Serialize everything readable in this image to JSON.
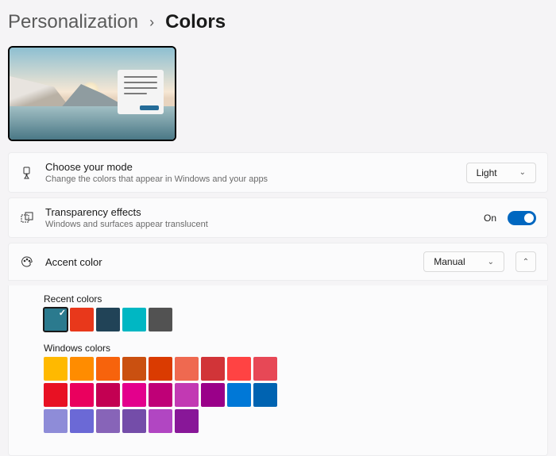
{
  "breadcrumb": {
    "parent": "Personalization",
    "current": "Colors"
  },
  "mode": {
    "title": "Choose your mode",
    "desc": "Change the colors that appear in Windows and your apps",
    "value": "Light"
  },
  "transparency": {
    "title": "Transparency effects",
    "desc": "Windows and surfaces appear translucent",
    "stateLabel": "On"
  },
  "accent": {
    "title": "Accent color",
    "value": "Manual",
    "recentLabel": "Recent colors",
    "windowsLabel": "Windows colors",
    "recent": [
      "#2b7a8e",
      "#e8381b",
      "#214357",
      "#00b7c3",
      "#525252"
    ],
    "selectedIndex": 0,
    "windows": [
      "#ffb900",
      "#ff8c00",
      "#f7630c",
      "#ca5010",
      "#da3b01",
      "#ef6950",
      "#d13438",
      "#ff4343",
      "#e74856",
      "#e81123",
      "#ea005e",
      "#c30052",
      "#e3008c",
      "#bf0077",
      "#c239b3",
      "#9a0089",
      "#0078d7",
      "#0063b1",
      "#8e8cd8",
      "#6b69d6",
      "#8764b8",
      "#744da9",
      "#b146c2",
      "#881798"
    ]
  }
}
